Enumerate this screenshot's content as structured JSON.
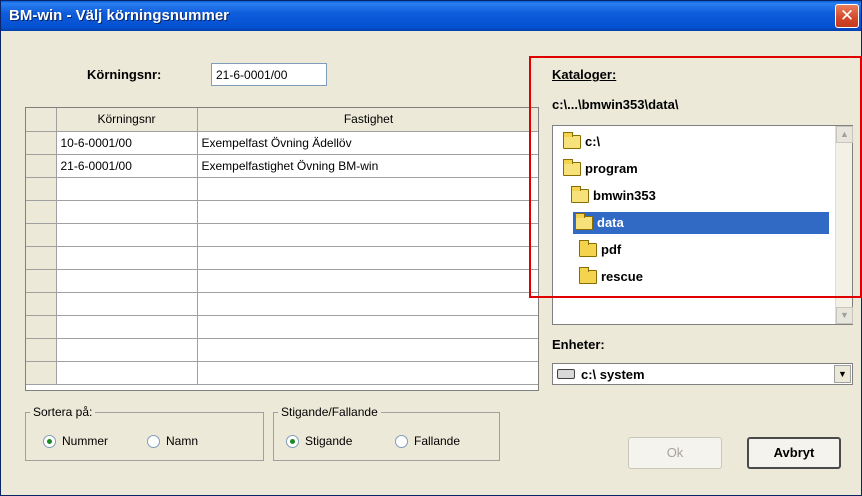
{
  "window": {
    "title": "BM-win - Välj körningsnummer",
    "close_glyph": "✕"
  },
  "nr_field": {
    "label": "Körningsnr:",
    "value": "21-6-0001/00"
  },
  "grid": {
    "columns": [
      "Körningsnr",
      "Fastighet"
    ],
    "rows": [
      {
        "nr": "10-6-0001/00",
        "fastighet": "Exempelfast Övning Ädellöv"
      },
      {
        "nr": "21-6-0001/00",
        "fastighet": "Exempelfastighet Övning BM-win"
      }
    ]
  },
  "sort_group": {
    "legend": "Sortera på:",
    "options": [
      "Nummer",
      "Namn"
    ],
    "selected": "Nummer"
  },
  "order_group": {
    "legend": "Stigande/Fallande",
    "options": [
      "Stigande",
      "Fallande"
    ],
    "selected": "Stigande"
  },
  "catalogs": {
    "label": "Kataloger:",
    "current_path": "c:\\...\\bmwin353\\data\\",
    "tree": [
      {
        "name": "c:\\",
        "level": 0,
        "open": true
      },
      {
        "name": "program",
        "level": 0,
        "open": true
      },
      {
        "name": "bmwin353",
        "level": 1,
        "open": true
      },
      {
        "name": "data",
        "level": 1,
        "open": true,
        "selected": true
      },
      {
        "name": "pdf",
        "level": 2,
        "open": false
      },
      {
        "name": "rescue",
        "level": 2,
        "open": false
      }
    ]
  },
  "drives": {
    "label": "Enheter:",
    "selected": "c:\\ system"
  },
  "buttons": {
    "ok": "Ok",
    "cancel": "Avbryt"
  },
  "colors": {
    "highlight_box": "#e00000",
    "selection": "#316ac5",
    "title_bar": "#0450d0"
  }
}
